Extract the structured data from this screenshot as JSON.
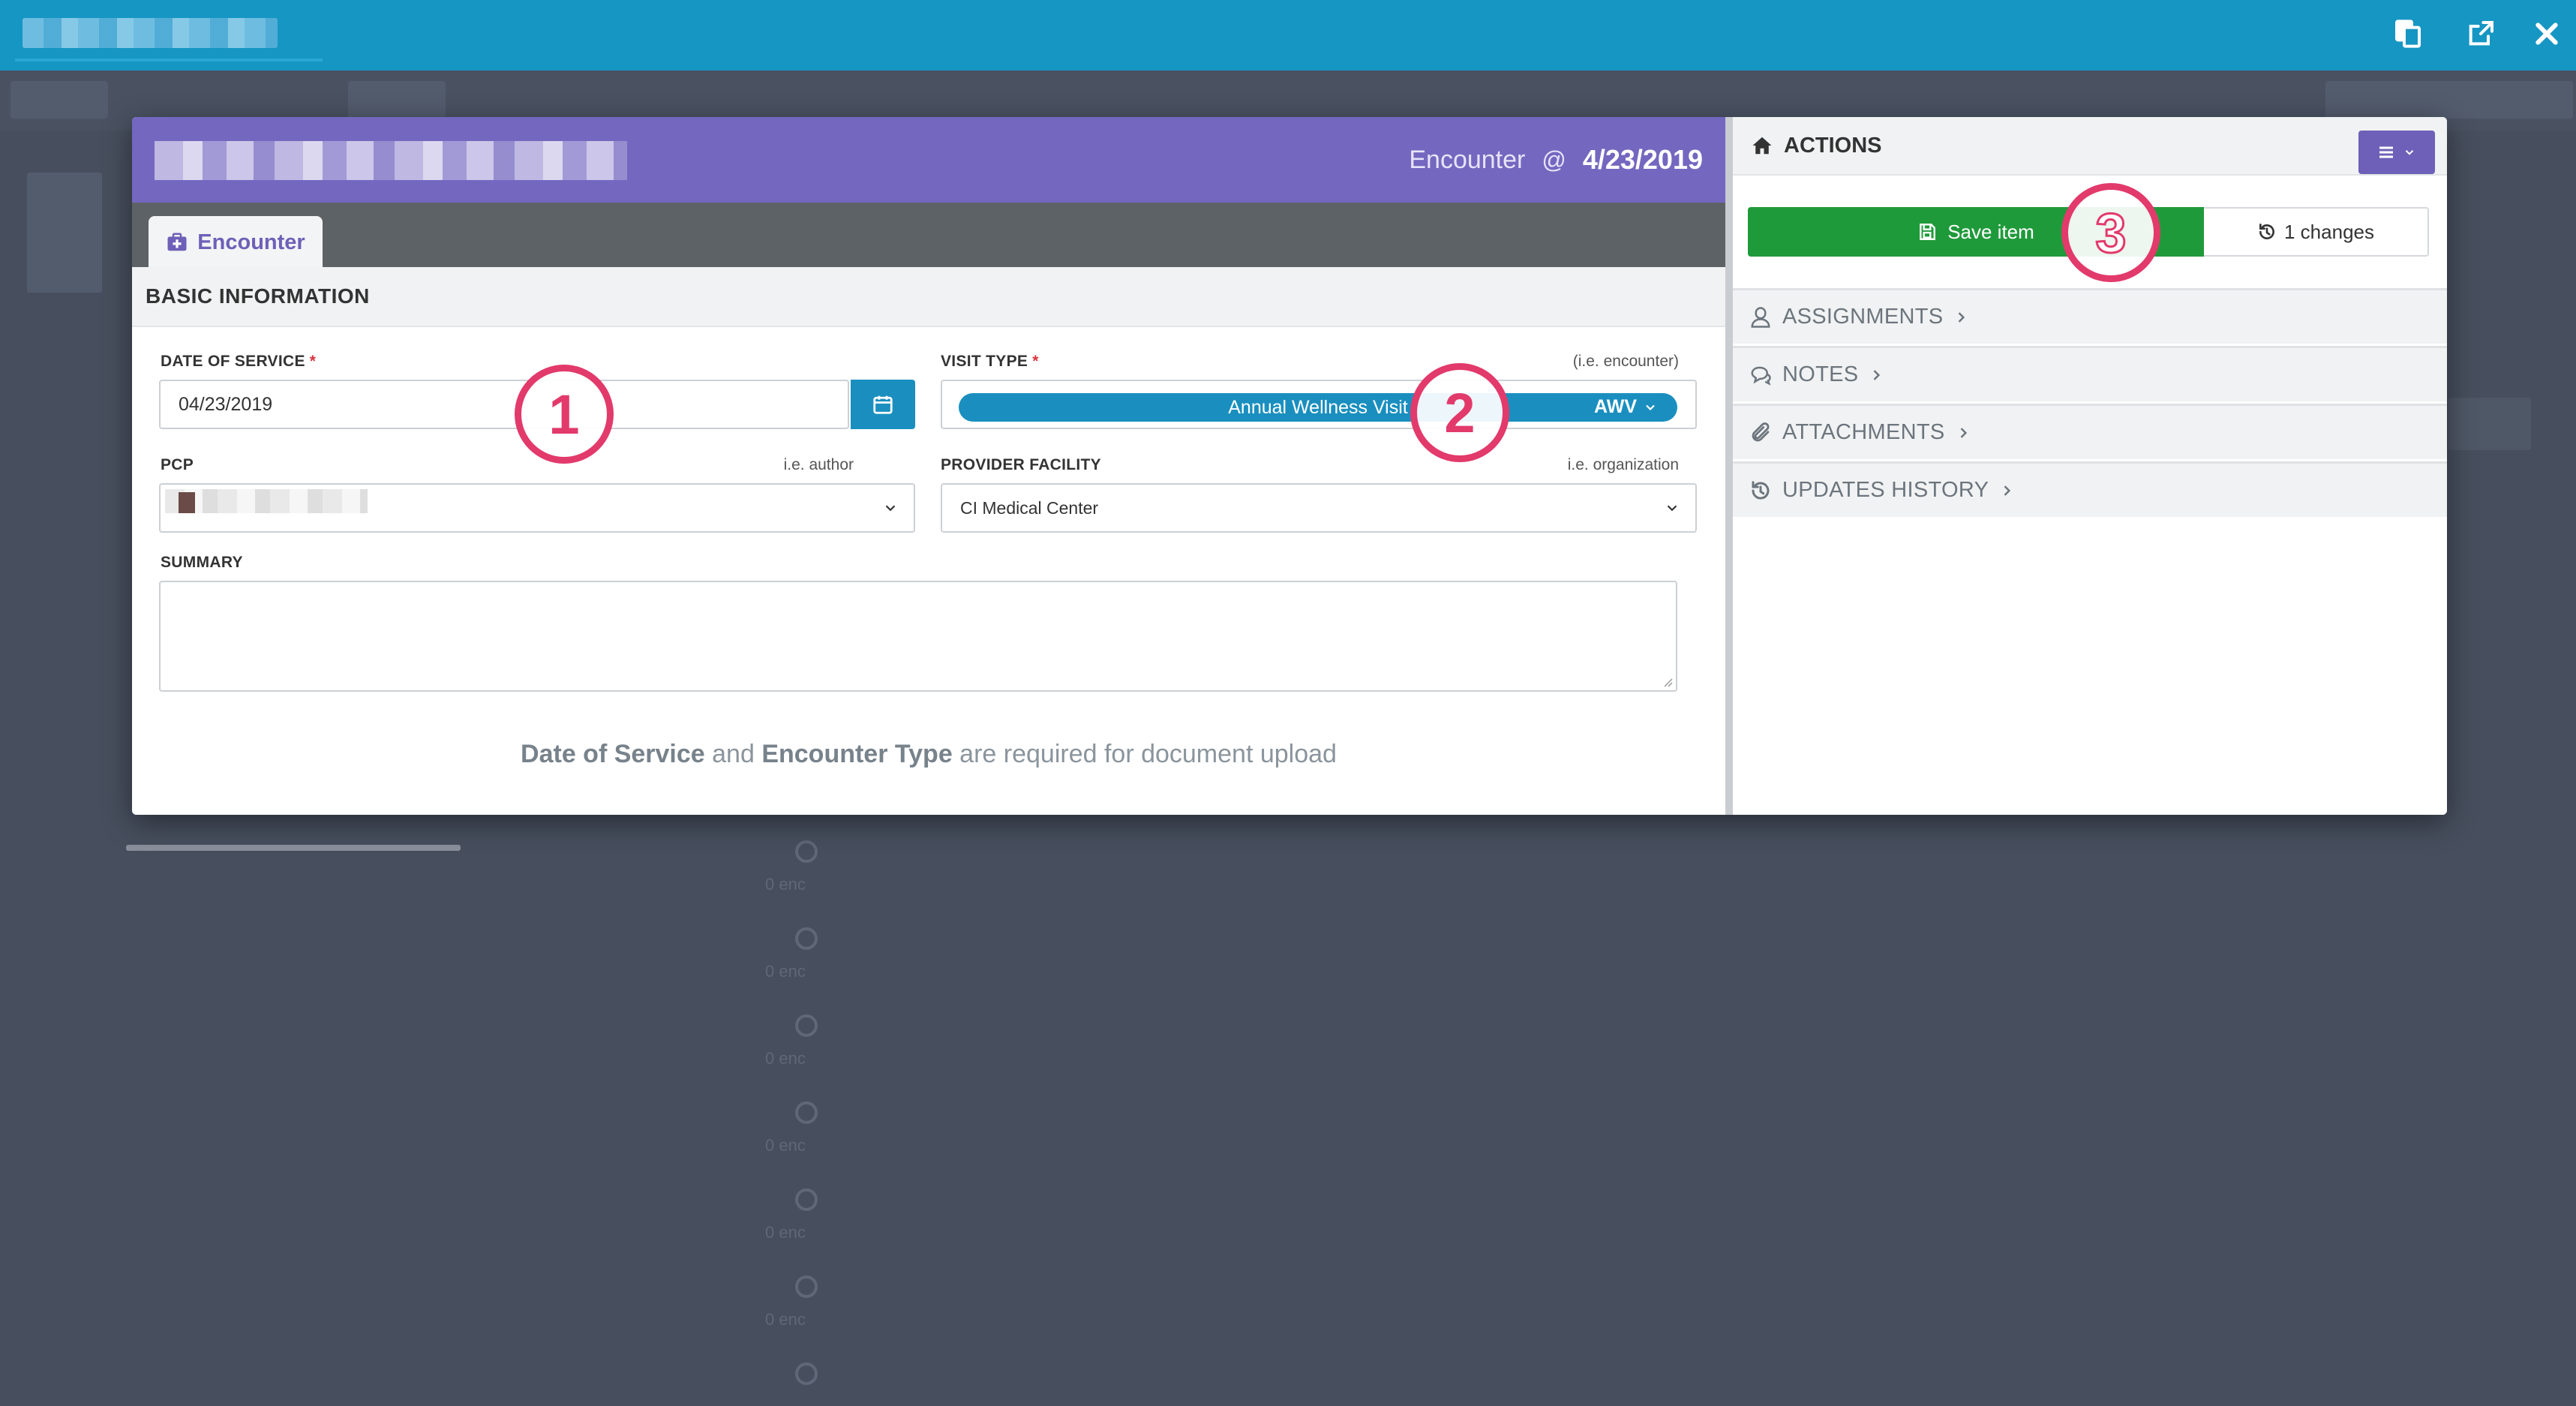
{
  "modal": {
    "header_label": "Encounter",
    "header_at": "@",
    "header_date": "4/23/2019",
    "tab_label": "Encounter",
    "section_title": "BASIC INFORMATION",
    "date_of_service": {
      "label": "DATE OF SERVICE",
      "required": "*",
      "value": "04/23/2019"
    },
    "visit_type": {
      "label": "VISIT TYPE",
      "required": "*",
      "hint": "(i.e. encounter)",
      "value": "Annual Wellness Visit",
      "code": "AWV"
    },
    "pcp": {
      "label": "PCP",
      "hint": "i.e. author"
    },
    "provider_facility": {
      "label": "PROVIDER FACILITY",
      "hint": "i.e. organization",
      "value": "CI Medical Center"
    },
    "summary": {
      "label": "SUMMARY",
      "value": ""
    },
    "note": {
      "part1": "Date of Service",
      "part2": " and ",
      "part3": "Encounter Type",
      "part4": " are required for document upload"
    }
  },
  "actions": {
    "title": "ACTIONS",
    "save_label": "Save item",
    "changes_label": "1 changes",
    "sections": [
      "ASSIGNMENTS",
      "NOTES",
      "ATTACHMENTS",
      "UPDATES HISTORY"
    ]
  },
  "annotations": [
    "1",
    "2",
    "3"
  ],
  "background": {
    "enc_label": "0 enc"
  },
  "colors": {
    "topbar": "#1696c3",
    "header": "#7467c0",
    "accent": "#1a8fbf",
    "save": "#1f9a3a",
    "marker": "#e23a6b"
  },
  "icons": [
    "documents-icon",
    "external-link-icon",
    "close-icon",
    "calendar-icon",
    "home-icon",
    "menu-icon",
    "save-icon",
    "history-icon",
    "user-icon",
    "comments-icon",
    "paperclip-icon"
  ]
}
